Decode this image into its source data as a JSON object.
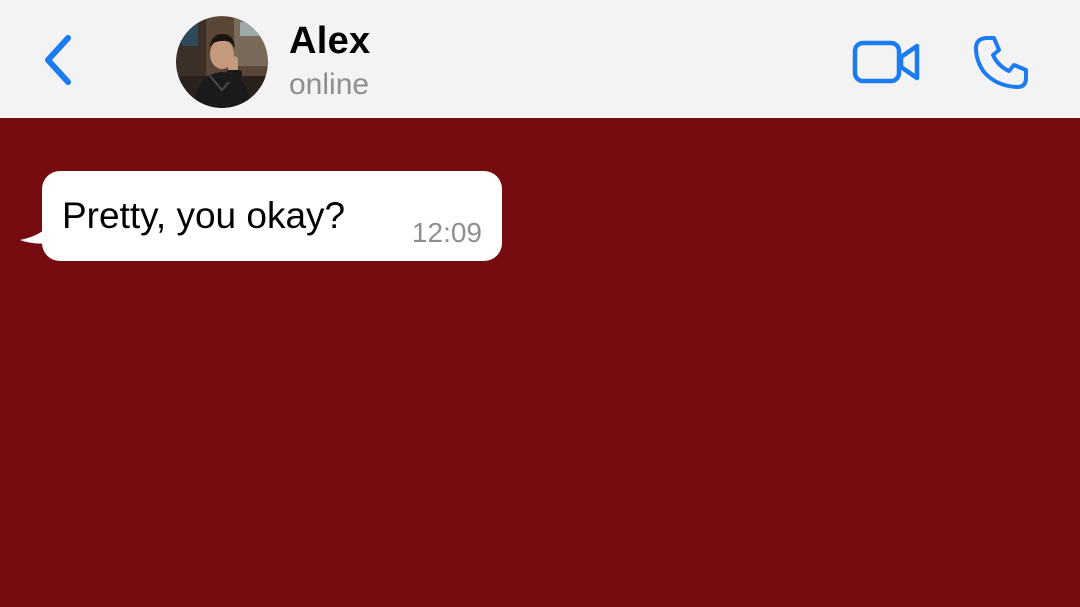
{
  "header": {
    "back_icon": "chevron-left-icon",
    "contact_name": "Alex",
    "contact_status": "online",
    "video_icon": "video-camera-icon",
    "call_icon": "phone-icon",
    "accent_color": "#1a7cf0"
  },
  "chat": {
    "background_color": "#760c0f",
    "messages": [
      {
        "text": "Pretty, you okay?",
        "time": "12:09",
        "direction": "incoming"
      }
    ]
  }
}
